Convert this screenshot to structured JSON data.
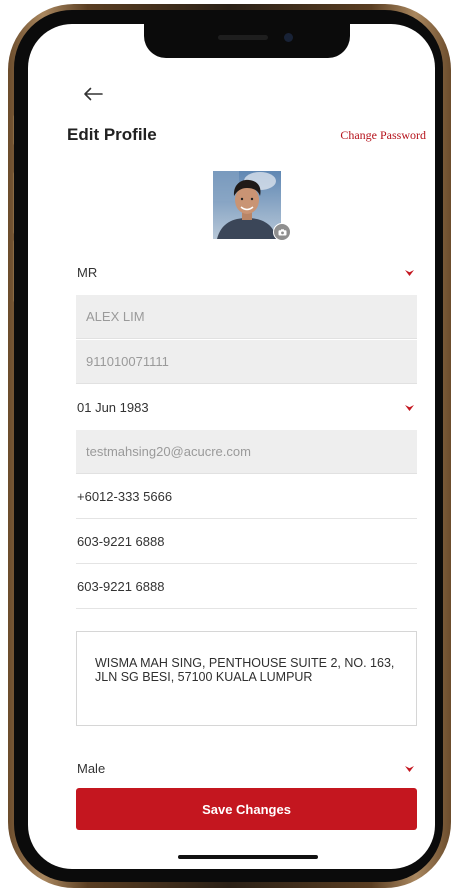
{
  "header": {
    "title": "Edit Profile",
    "change_password_label": "Change Password"
  },
  "profile": {
    "salutation": "MR",
    "name": "ALEX LIM",
    "ic_number": "911010071111",
    "date_of_birth": "01 Jun 1983",
    "email": "testmahsing20@acucre.com",
    "mobile": "+6012-333 5666",
    "phone_home": "603-9221 6888",
    "phone_office": "603-9221 6888",
    "address": "WISMA MAH SING, PENTHOUSE SUITE 2, NO. 163, JLN SG BESI, 57100 KUALA LUMPUR",
    "gender": "Male"
  },
  "actions": {
    "save_label": "Save Changes"
  },
  "icons": {
    "back": "arrow-left-icon",
    "dropdown": "chevron-down-icon",
    "avatar_edit": "camera-icon"
  },
  "colors": {
    "accent": "#c4161f",
    "filled_field": "#eeeeee",
    "text": "#333333"
  }
}
